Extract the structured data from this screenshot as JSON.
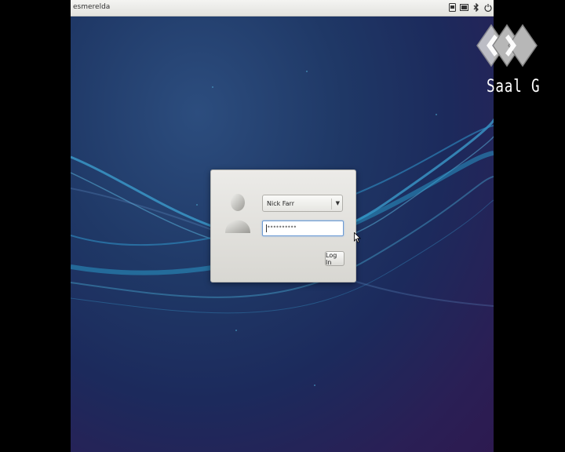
{
  "topbar": {
    "hostname": "esmerelda",
    "icons": [
      "keyboard-icon",
      "battery-icon",
      "bluetooth-icon",
      "power-icon"
    ]
  },
  "login": {
    "user_selected": "Nick Farr",
    "password_value": "••••••••••",
    "login_label": "Log In"
  },
  "watermark": {
    "text": "Saal G"
  },
  "colors": {
    "accent_wave": "#3fa8d8",
    "focus_border": "#6c9bd3"
  }
}
